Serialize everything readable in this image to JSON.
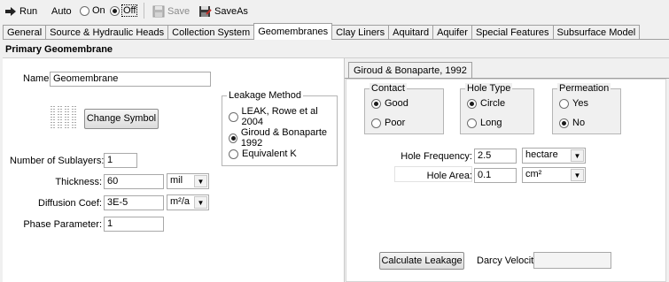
{
  "toolbar": {
    "run_label": "Run",
    "auto_label": "Auto",
    "on_label": "On",
    "off_label": "Off",
    "auto_mode": "Off",
    "save_label": "Save",
    "saveas_label": "SaveAs"
  },
  "tabs": [
    "General",
    "Source & Hydraulic Heads",
    "Collection System",
    "Geomembranes",
    "Clay Liners",
    "Aquitard",
    "Aquifer",
    "Special Features",
    "Subsurface Model"
  ],
  "active_tab": "Geomembranes",
  "section_title": "Primary Geomembrane",
  "left": {
    "name_label": "Name:",
    "name_value": "Geomembrane",
    "change_symbol_label": "Change Symbol",
    "sublayers_label": "Number of Sublayers:",
    "sublayers_value": "1",
    "thickness_label": "Thickness:",
    "thickness_value": "60",
    "thickness_unit": "mil",
    "diffusion_label": "Diffusion Coef:",
    "diffusion_value": "3E-5",
    "diffusion_unit": "m²/a",
    "phase_label": "Phase Parameter:",
    "phase_value": "1"
  },
  "leakage": {
    "title": "Leakage Method",
    "options": [
      "LEAK, Rowe et al 2004",
      "Giroud & Bonaparte 1992",
      "Equivalent K"
    ],
    "selected": "Giroud & Bonaparte 1992"
  },
  "right_panel": {
    "tab_label": "Giroud & Bonaparte, 1992",
    "contact": {
      "title": "Contact",
      "options": [
        "Good",
        "Poor"
      ],
      "selected": "Good"
    },
    "hole_type": {
      "title": "Hole Type",
      "options": [
        "Circle",
        "Long"
      ],
      "selected": "Circle"
    },
    "permeation": {
      "title": "Permeation",
      "options": [
        "Yes",
        "No"
      ],
      "selected": "No"
    },
    "hole_frequency_label": "Hole Frequency:",
    "hole_frequency_value": "2.5",
    "hole_frequency_unit": "hectare",
    "hole_area_label": "Hole Area:",
    "hole_area_value": "0.1",
    "hole_area_unit": "cm²",
    "calculate_label": "Calculate Leakage",
    "darcy_label": "Darcy Velocity",
    "darcy_value": ""
  }
}
